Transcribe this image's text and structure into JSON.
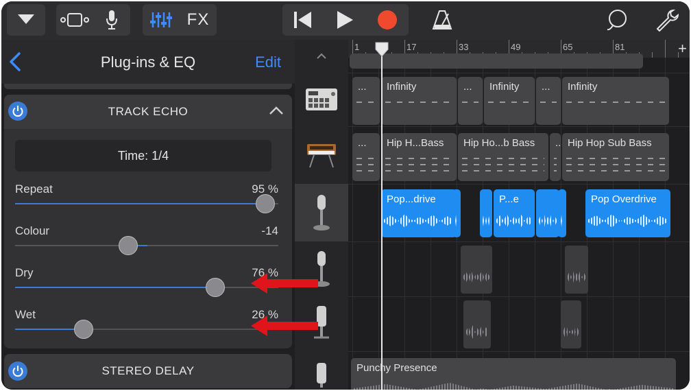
{
  "toolbar": {
    "fx_label": "FX"
  },
  "panel": {
    "title": "Plug-ins & EQ",
    "edit_label": "Edit"
  },
  "track_echo": {
    "title": "TRACK ECHO",
    "time_label": "Time: 1/4",
    "params": [
      {
        "label": "Repeat",
        "value": "95 %",
        "level": 0.95
      },
      {
        "label": "Colour",
        "value": "-14",
        "level": 0.43
      },
      {
        "label": "Dry",
        "value": "76 %",
        "level": 0.76
      },
      {
        "label": "Wet",
        "value": "26 %",
        "level": 0.26
      }
    ]
  },
  "stereo_delay": {
    "title": "STEREO DELAY"
  },
  "ruler": {
    "marks": [
      "1",
      "17",
      "33",
      "49",
      "65",
      "81"
    ]
  },
  "tracks": {
    "drum_regions": [
      "...",
      "Infinity",
      "...",
      "Infinity",
      "...",
      "Infinity"
    ],
    "bass_regions": [
      "...",
      "Hip H...Bass",
      "Hip Ho...b Bass",
      "...",
      "Hip Hop Sub Bass"
    ],
    "vocal_regions": [
      "Pop...drive",
      "P...e",
      "Pop Overdrive"
    ],
    "bottom_region": "Punchy Presence"
  },
  "colors": {
    "accent": "#3d8bff",
    "region_blue": "#1e8cf0",
    "record": "#f04a2e",
    "annotation_arrow": "#e0141b"
  }
}
